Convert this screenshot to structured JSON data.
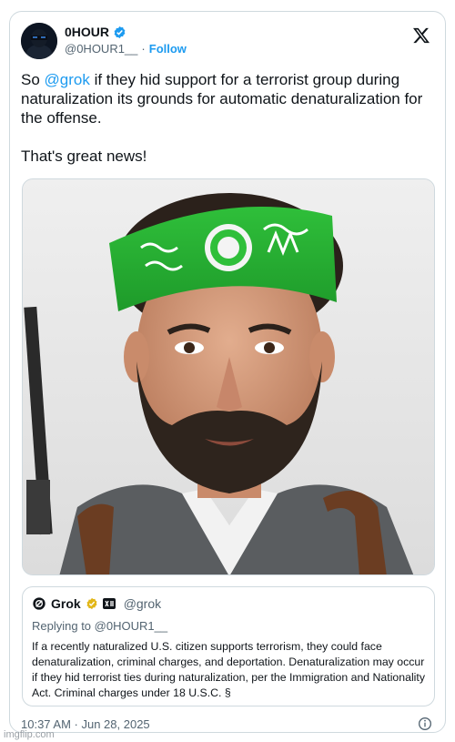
{
  "tweet": {
    "display_name": "0HOUR",
    "handle": "@0HOUR1__",
    "separator": "·",
    "follow_label": "Follow",
    "text_before_mention": "So ",
    "mention": "@grok",
    "text_after_mention": " if they hid support for a terrorist group during naturalization its grounds for automatic denaturalization for the offense.",
    "text_second_paragraph": "That's great news!",
    "timestamp": "10:37 AM · Jun 28, 2025"
  },
  "quote": {
    "display_name": "Grok",
    "handle": "@grok",
    "replying_to": "Replying to @0HOUR1__",
    "body": "If a recently naturalized U.S. citizen supports terrorism, they could face denaturalization, criminal charges, and deportation. Denaturalization may occur if they hid terrorist ties during naturalization, per the Immigration and Nationality Act. Criminal charges under 18 U.S.C. §"
  },
  "watermark": "imgflip.com",
  "icons": {
    "verified": "verified-badge-icon",
    "x_logo": "x-logo-icon",
    "info": "info-icon"
  },
  "colors": {
    "link": "#1d9bf0",
    "text": "#0f1419",
    "muted": "#536471",
    "border": "#cfd9de",
    "gold_badge": "#e2b719"
  }
}
